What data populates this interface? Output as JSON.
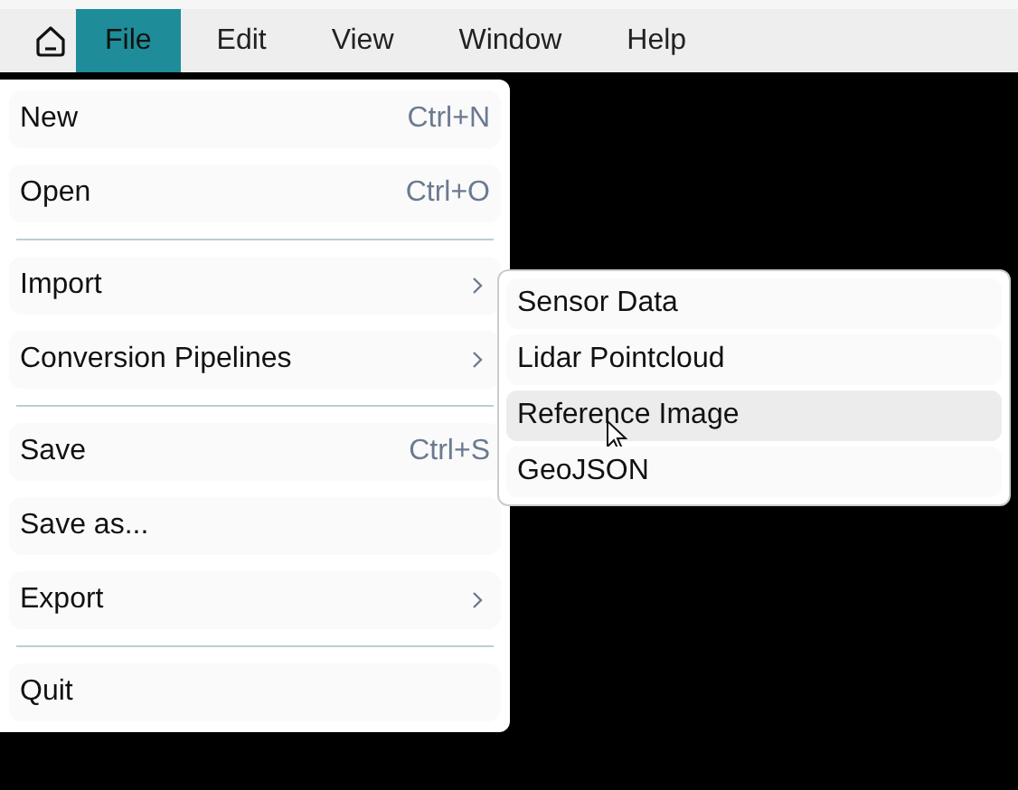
{
  "menubar": {
    "items": [
      {
        "label": "File",
        "selected": true
      },
      {
        "label": "Edit",
        "selected": false
      },
      {
        "label": "View",
        "selected": false
      },
      {
        "label": "Window",
        "selected": false
      },
      {
        "label": "Help",
        "selected": false
      }
    ]
  },
  "file_menu": {
    "items": [
      {
        "kind": "item",
        "label": "New",
        "shortcut": "Ctrl+N",
        "has_submenu": false
      },
      {
        "kind": "item",
        "label": "Open",
        "shortcut": "Ctrl+O",
        "has_submenu": false
      },
      {
        "kind": "separator"
      },
      {
        "kind": "item",
        "label": "Import",
        "has_submenu": true
      },
      {
        "kind": "item",
        "label": "Conversion Pipelines",
        "has_submenu": true
      },
      {
        "kind": "separator"
      },
      {
        "kind": "item",
        "label": "Save",
        "shortcut": "Ctrl+S",
        "has_submenu": false
      },
      {
        "kind": "item",
        "label": "Save as...",
        "has_submenu": false
      },
      {
        "kind": "item",
        "label": "Export",
        "has_submenu": true
      },
      {
        "kind": "separator"
      },
      {
        "kind": "item",
        "label": "Quit",
        "has_submenu": false
      }
    ]
  },
  "import_submenu": {
    "items": [
      {
        "label": "Sensor Data",
        "selected": false
      },
      {
        "label": "Lidar Pointcloud",
        "selected": false
      },
      {
        "label": "Reference Image",
        "selected": true
      },
      {
        "label": "GeoJSON",
        "selected": false
      }
    ]
  }
}
